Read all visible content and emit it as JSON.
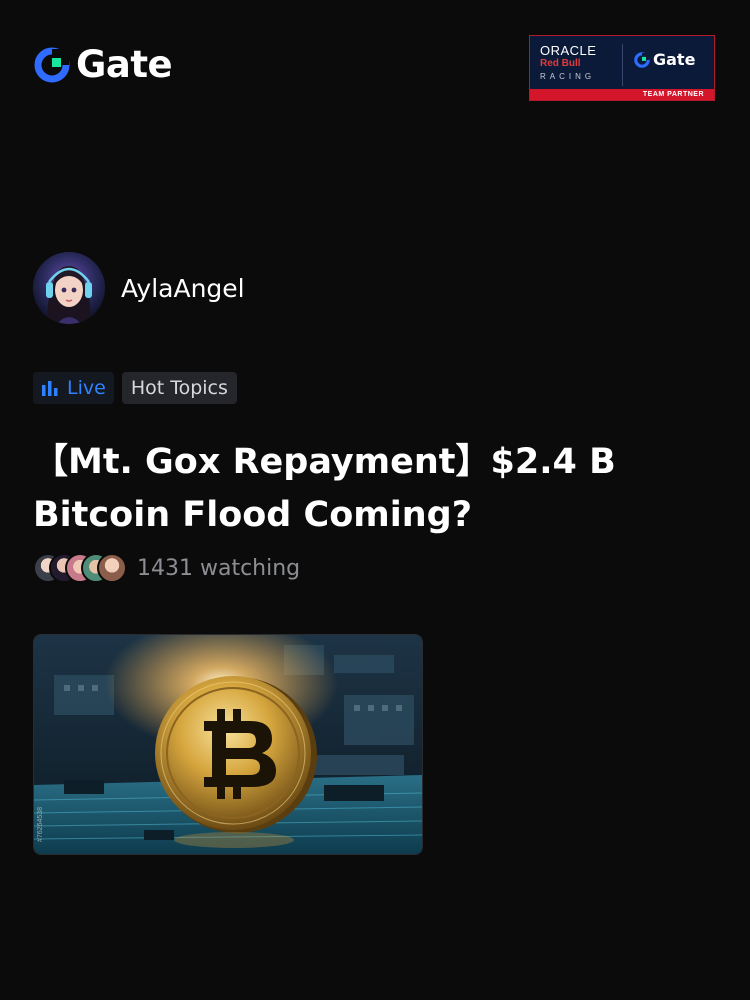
{
  "header": {
    "logo_text": "Gate",
    "partner": {
      "line1": "ORACLE",
      "line2": "Red Bull",
      "line3": "RACING",
      "brand": "Gate",
      "ribbon": "TEAM PARTNER"
    }
  },
  "author": {
    "name": "AylaAngel"
  },
  "tags": {
    "live": "Live",
    "topic": "Hot Topics"
  },
  "post": {
    "title": "【Mt. Gox Repayment】$2.4 B Bitcoin Flood Coming?",
    "watching": "1431 watching",
    "image_id": "#76264538"
  },
  "colors": {
    "accent_blue": "#2f82ff",
    "logo_green": "#17e6a1",
    "background": "#0b0b0c"
  },
  "icons": [
    "gate-logo-icon",
    "live-bars-icon",
    "avatar",
    "bitcoin-thumbnail"
  ]
}
